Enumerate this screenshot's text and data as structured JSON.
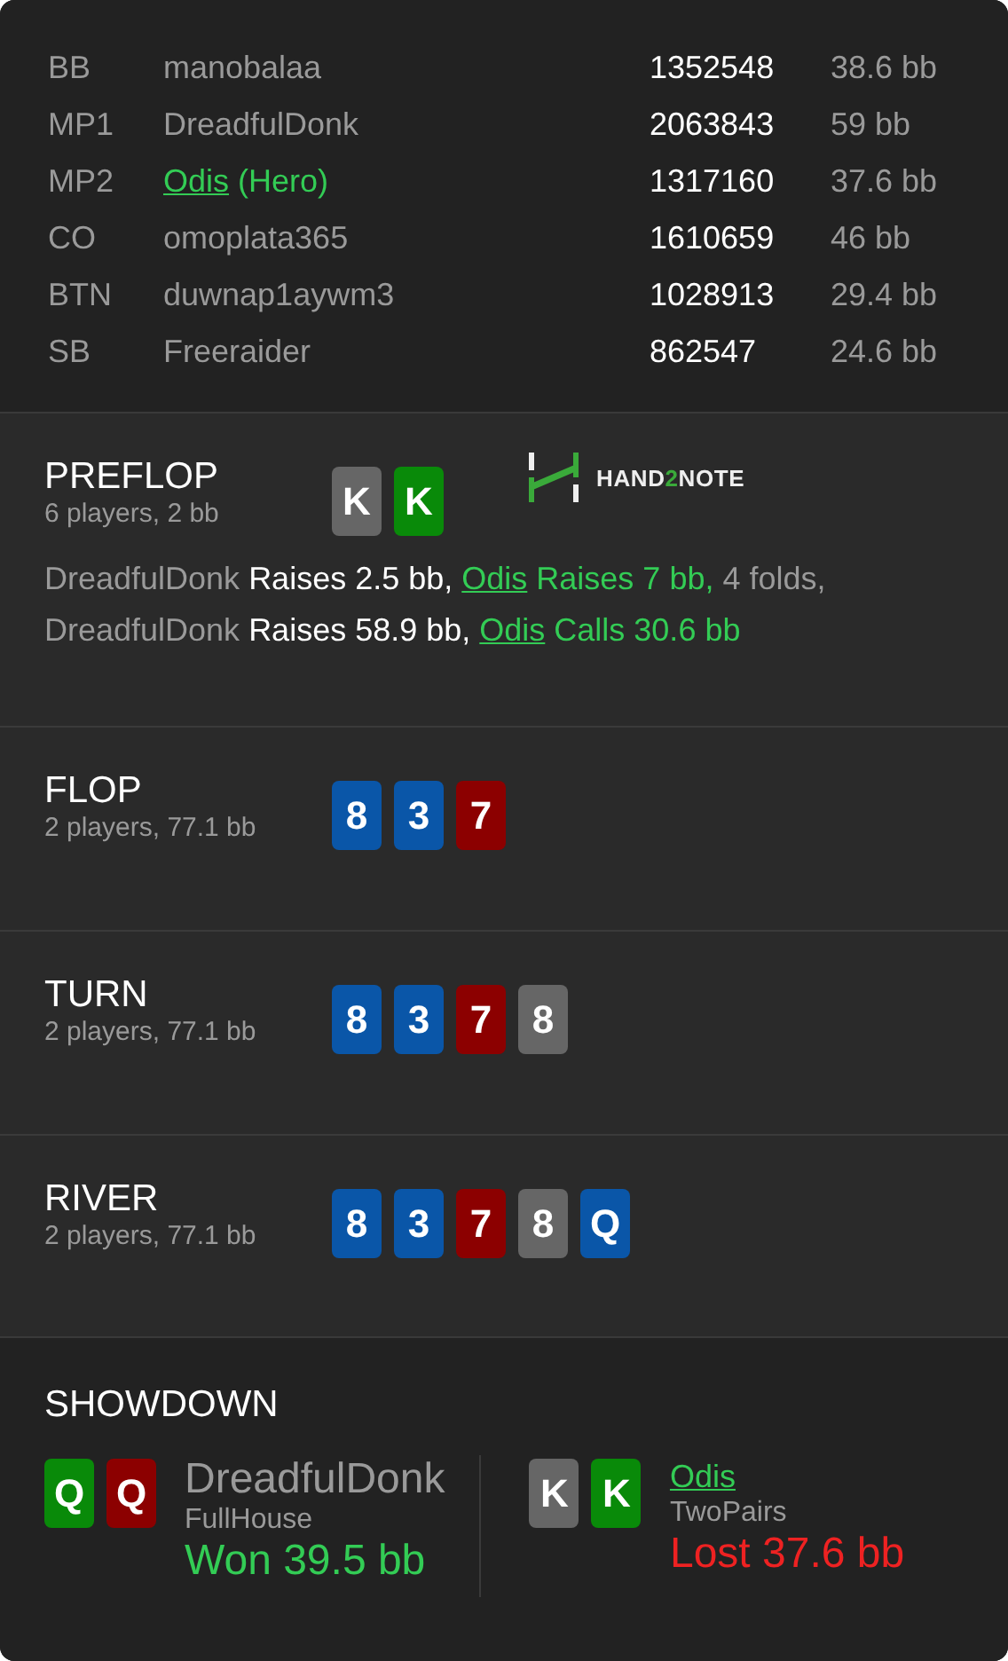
{
  "players": [
    {
      "position": "BB",
      "name": "manobalaa",
      "hero": false,
      "stack": "1352548",
      "bb": "38.6 bb"
    },
    {
      "position": "MP1",
      "name": "DreadfulDonk",
      "hero": false,
      "stack": "2063843",
      "bb": "59 bb"
    },
    {
      "position": "MP2",
      "name": "Odis",
      "hero_tag": "(Hero)",
      "hero": true,
      "stack": "1317160",
      "bb": "37.6 bb"
    },
    {
      "position": "CO",
      "name": "omoplata365",
      "hero": false,
      "stack": "1610659",
      "bb": "46 bb"
    },
    {
      "position": "BTN",
      "name": "duwnap1aywm3",
      "hero": false,
      "stack": "1028913",
      "bb": "29.4 bb"
    },
    {
      "position": "SB",
      "name": "Freeraider",
      "hero": false,
      "stack": "862547",
      "bb": "24.6 bb"
    }
  ],
  "streets": [
    {
      "title": "PREFLOP",
      "info": "6 players, 2 bb",
      "cards": [
        {
          "rank": "K",
          "color": "#666666"
        },
        {
          "rank": "K",
          "color": "#098a09"
        }
      ],
      "logo": [
        "HAND",
        "2",
        "NOTE"
      ],
      "actions": [
        [
          {
            "kind": "player",
            "text": "DreadfulDonk"
          },
          {
            "kind": "action",
            "text": "Raises 2.5 bb,"
          },
          {
            "kind": "hero",
            "text": "Odis"
          },
          {
            "kind": "hero_action",
            "text": "Raises 7 bb,"
          },
          {
            "kind": "plain",
            "text": "4 folds,"
          }
        ],
        [
          {
            "kind": "player",
            "text": "DreadfulDonk"
          },
          {
            "kind": "action",
            "text": "Raises 58.9 bb,"
          },
          {
            "kind": "hero",
            "text": "Odis"
          },
          {
            "kind": "hero_action",
            "text": "Calls 30.6 bb"
          }
        ]
      ]
    },
    {
      "title": "FLOP",
      "info": "2 players, 77.1 bb",
      "cards": [
        {
          "rank": "8",
          "color": "#0a56a8"
        },
        {
          "rank": "3",
          "color": "#0a56a8"
        },
        {
          "rank": "7",
          "color": "#8c0000"
        }
      ]
    },
    {
      "title": "TURN",
      "info": "2 players, 77.1 bb",
      "cards": [
        {
          "rank": "8",
          "color": "#0a56a8"
        },
        {
          "rank": "3",
          "color": "#0a56a8"
        },
        {
          "rank": "7",
          "color": "#8c0000"
        },
        {
          "rank": "8",
          "color": "#666666"
        }
      ]
    },
    {
      "title": "RIVER",
      "info": "2 players, 77.1 bb",
      "cards": [
        {
          "rank": "8",
          "color": "#0a56a8"
        },
        {
          "rank": "3",
          "color": "#0a56a8"
        },
        {
          "rank": "7",
          "color": "#8c0000"
        },
        {
          "rank": "8",
          "color": "#666666"
        },
        {
          "rank": "Q",
          "color": "#0a56a8"
        }
      ]
    }
  ],
  "showdown": {
    "title": "SHOWDOWN",
    "hands": [
      {
        "player": "DreadfulDonk",
        "hero": false,
        "combo": "FullHouse",
        "result": "Won 39.5 bb",
        "won": true,
        "cards": [
          {
            "rank": "Q",
            "color": "#098a09"
          },
          {
            "rank": "Q",
            "color": "#8c0000"
          }
        ]
      },
      {
        "player": "Odis",
        "hero": true,
        "combo": "TwoPairs",
        "result": "Lost 37.6 bb",
        "won": false,
        "cards": [
          {
            "rank": "K",
            "color": "#666666"
          },
          {
            "rank": "K",
            "color": "#098a09"
          }
        ]
      }
    ]
  }
}
